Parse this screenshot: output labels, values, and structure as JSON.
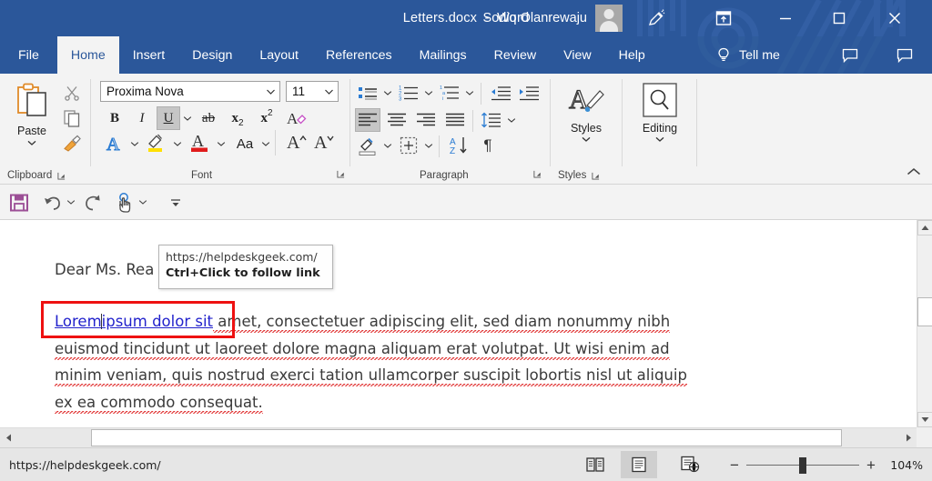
{
  "titlebar": {
    "document_title": "Letters.docx  -  Word",
    "user_name": "Sodiq Olanrewaju",
    "avatar_name": "user-avatar",
    "ink_icon": "pen-ink-icon",
    "ribbon_display_icon": "ribbon-display-options-icon",
    "minimize_icon": "minimize-icon",
    "maximize_icon": "maximize-icon",
    "close_icon": "close-icon",
    "accent_color": "#2b579a"
  },
  "tabs": [
    {
      "label": "File",
      "active": false
    },
    {
      "label": "Home",
      "active": true
    },
    {
      "label": "Insert",
      "active": false
    },
    {
      "label": "Design",
      "active": false
    },
    {
      "label": "Layout",
      "active": false
    },
    {
      "label": "References",
      "active": false
    },
    {
      "label": "Mailings",
      "active": false
    },
    {
      "label": "Review",
      "active": false
    },
    {
      "label": "View",
      "active": false
    },
    {
      "label": "Help",
      "active": false
    }
  ],
  "tellme": {
    "label": "Tell me",
    "icon": "lightbulb-icon"
  },
  "comments": {
    "comment_icon": "comment-bubble-icon",
    "share_icon": "share-comment-icon"
  },
  "ribbon": {
    "groups": [
      {
        "name": "Clipboard",
        "label": "Clipboard"
      },
      {
        "name": "Font",
        "label": "Font"
      },
      {
        "name": "Paragraph",
        "label": "Paragraph"
      },
      {
        "name": "Styles",
        "label": "Styles"
      }
    ],
    "clipboard": {
      "paste_label": "Paste",
      "paste_icon": "paste-icon",
      "cut_icon": "scissors-icon",
      "copy_icon": "copy-icon",
      "format_painter_icon": "format-painter-icon"
    },
    "font": {
      "font_name": "Proxima Nova",
      "font_size": "11",
      "bold_label": "B",
      "italic_label": "I",
      "underline_label": "U",
      "strikethrough_label": "ab",
      "subscript_label": "x",
      "superscript_label": "x",
      "clear_formatting_icon": "clear-formatting-icon",
      "text_effects_icon": "text-effects-icon",
      "highlight_icon": "text-highlight-icon",
      "font_color_icon": "font-color-icon",
      "change_case_label": "Aa",
      "grow_font_label": "A",
      "shrink_font_label": "A",
      "highlight_color": "#ffe000",
      "font_color": "#e01b1b"
    },
    "paragraph": {
      "bullets_icon": "bullet-list-icon",
      "numbering_icon": "numbered-list-icon",
      "multilevel_icon": "multilevel-list-icon",
      "decrease_indent_icon": "decrease-indent-icon",
      "increase_indent_icon": "increase-indent-icon",
      "align_left_icon": "align-left-icon",
      "align_center_icon": "align-center-icon",
      "align_right_icon": "align-right-icon",
      "justify_icon": "justify-icon",
      "line_spacing_icon": "line-spacing-icon",
      "shading_icon": "shading-icon",
      "borders_icon": "borders-icon",
      "sort_icon": "sort-icon",
      "show_marks_label": "¶"
    },
    "styles": {
      "label": "Styles",
      "icon": "styles-icon"
    },
    "editing": {
      "label": "Editing",
      "icon": "find-magnifier-icon"
    },
    "collapse_icon": "collapse-ribbon-icon"
  },
  "quick_access": {
    "save_icon": "save-floppy-icon",
    "save_color": "#9c4f96",
    "undo_icon": "undo-icon",
    "redo_icon": "redo-icon",
    "touch_mode_icon": "touch-mouse-mode-icon",
    "more_icon": "customize-qat-icon"
  },
  "document": {
    "salutation": "Dear Ms. Rea",
    "paragraph": {
      "link_text_1": "Lorem",
      "link_text_2": "ipsum dolor sit",
      "rest": " amet, consectetuer adipiscing elit, sed diam nonummy nibh euismod tincidunt ut laoreet dolore magna aliquam erat volutpat. Ut wisi enim ad minim veniam, quis nostrud exerci tation ullamcorper suscipit lobortis nisl ut aliquip ex ea commodo consequat."
    },
    "link_color": "#2222cc",
    "annotation_color": "#ee1111",
    "spellcheck_color": "#e03030"
  },
  "tooltip": {
    "url": "https://helpdeskgeek.com/",
    "hint": "Ctrl+Click to follow link"
  },
  "statusbar": {
    "link_status": "https://helpdeskgeek.com/",
    "read_mode_icon": "read-mode-icon",
    "print_layout_icon": "print-layout-icon",
    "web_layout_icon": "web-layout-icon",
    "zoom_out_label": "−",
    "zoom_in_label": "+",
    "zoom_level": "104%"
  }
}
